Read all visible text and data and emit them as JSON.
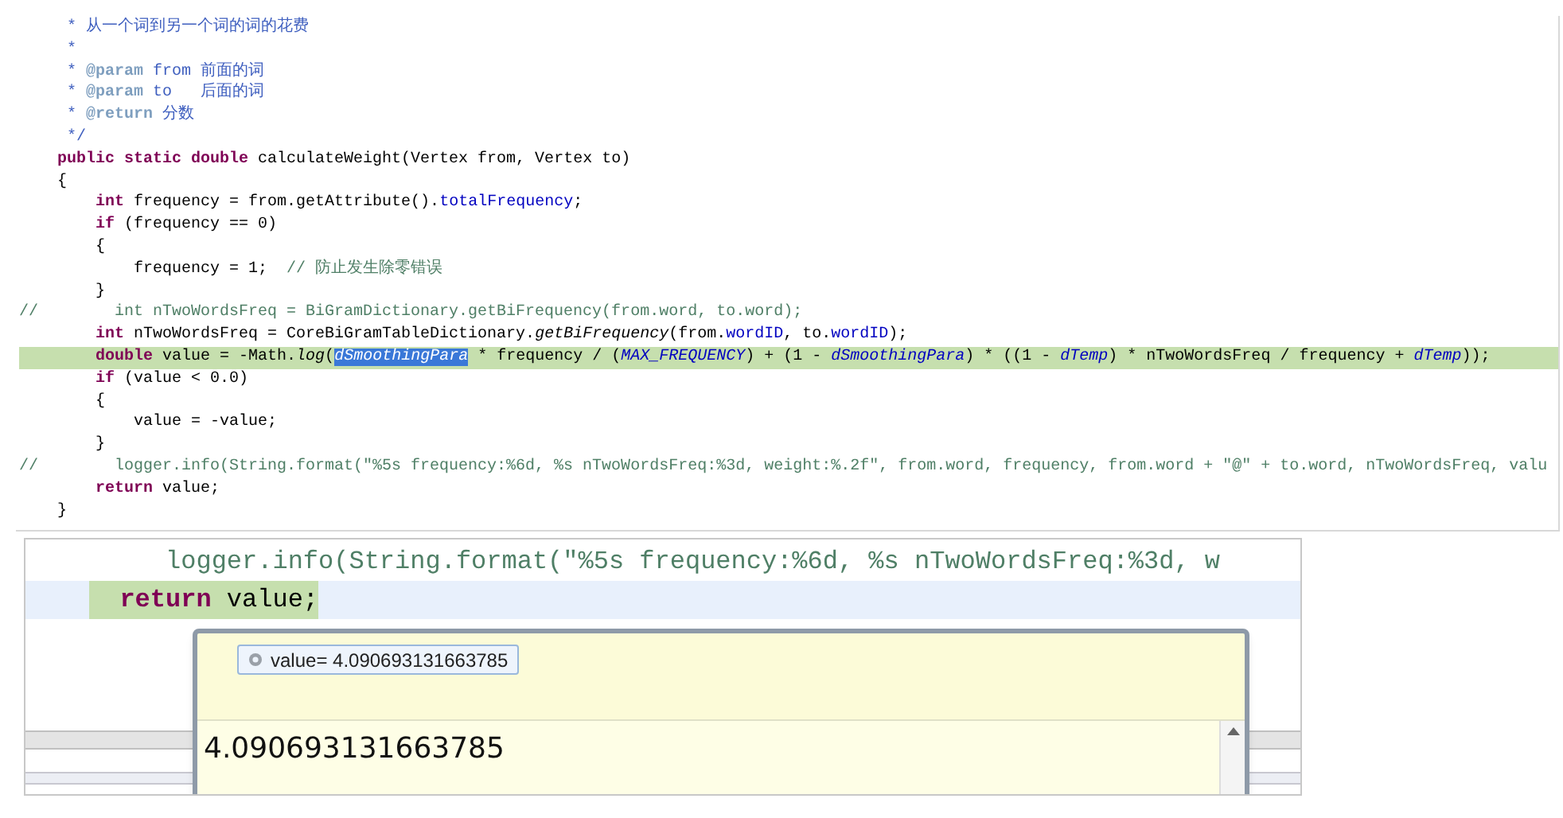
{
  "editor": {
    "lines": [
      {
        "current": false,
        "tokens": [
          {
            "kind": "doc",
            "text": "     * 从一个词到另一个词的词的花费"
          }
        ]
      },
      {
        "current": false,
        "tokens": [
          {
            "kind": "doc",
            "text": "     *"
          }
        ]
      },
      {
        "current": false,
        "tokens": [
          {
            "kind": "doc",
            "text": "     * "
          },
          {
            "kind": "doctag",
            "text": "@param"
          },
          {
            "kind": "doc",
            "text": " from 前面的词"
          }
        ]
      },
      {
        "current": false,
        "tokens": [
          {
            "kind": "doc",
            "text": "     * "
          },
          {
            "kind": "doctag",
            "text": "@param"
          },
          {
            "kind": "doc",
            "text": " to   后面的词"
          }
        ]
      },
      {
        "current": false,
        "tokens": [
          {
            "kind": "doc",
            "text": "     * "
          },
          {
            "kind": "doctag",
            "text": "@return"
          },
          {
            "kind": "doc",
            "text": " 分数"
          }
        ]
      },
      {
        "current": false,
        "tokens": [
          {
            "kind": "doc",
            "text": "     */"
          }
        ]
      },
      {
        "current": false,
        "tokens": [
          {
            "kind": "keyword",
            "text": "    public static double"
          },
          {
            "kind": "plain",
            "text": " calculateWeight(Vertex from, Vertex to)"
          }
        ]
      },
      {
        "current": false,
        "tokens": [
          {
            "kind": "plain",
            "text": "    {"
          }
        ]
      },
      {
        "current": false,
        "tokens": [
          {
            "kind": "keyword",
            "text": "        int"
          },
          {
            "kind": "plain",
            "text": " frequency = from.getAttribute()."
          },
          {
            "kind": "field",
            "text": "totalFrequency"
          },
          {
            "kind": "plain",
            "text": ";"
          }
        ]
      },
      {
        "current": false,
        "tokens": [
          {
            "kind": "keyword",
            "text": "        if"
          },
          {
            "kind": "plain",
            "text": " (frequency == 0)"
          }
        ]
      },
      {
        "current": false,
        "tokens": [
          {
            "kind": "plain",
            "text": "        {"
          }
        ]
      },
      {
        "current": false,
        "tokens": [
          {
            "kind": "plain",
            "text": "            frequency = 1;  "
          },
          {
            "kind": "comment",
            "text": "// 防止发生除零错误"
          }
        ]
      },
      {
        "current": false,
        "tokens": [
          {
            "kind": "plain",
            "text": "        }"
          }
        ]
      },
      {
        "current": false,
        "tokens": [
          {
            "kind": "comment",
            "text": "//        int nTwoWordsFreq = BiGramDictionary.getBiFrequency(from.word, to.word);"
          }
        ]
      },
      {
        "current": false,
        "tokens": [
          {
            "kind": "keyword",
            "text": "        int"
          },
          {
            "kind": "plain",
            "text": " nTwoWordsFreq = CoreBiGramTableDictionary."
          },
          {
            "kind": "static_method",
            "text": "getBiFrequency"
          },
          {
            "kind": "plain",
            "text": "(from."
          },
          {
            "kind": "field",
            "text": "wordID"
          },
          {
            "kind": "plain",
            "text": ", to."
          },
          {
            "kind": "field",
            "text": "wordID"
          },
          {
            "kind": "plain",
            "text": ");"
          }
        ]
      },
      {
        "current": true,
        "tokens": [
          {
            "kind": "keyword",
            "text": "        double"
          },
          {
            "kind": "plain",
            "text": " value = -Math."
          },
          {
            "kind": "static_method",
            "text": "log"
          },
          {
            "kind": "plain",
            "text": "("
          },
          {
            "kind": "selection",
            "text": "dSmoothingPara"
          },
          {
            "kind": "plain",
            "text": " * frequency / ("
          },
          {
            "kind": "static_field",
            "text": "MAX_FREQUENCY"
          },
          {
            "kind": "plain",
            "text": ") + (1 - "
          },
          {
            "kind": "static_field",
            "text": "dSmoothingPara"
          },
          {
            "kind": "plain",
            "text": ") * ((1 - "
          },
          {
            "kind": "static_field",
            "text": "dTemp"
          },
          {
            "kind": "plain",
            "text": ") * nTwoWordsFreq / frequency + "
          },
          {
            "kind": "static_field",
            "text": "dTemp"
          },
          {
            "kind": "plain",
            "text": "));"
          }
        ]
      },
      {
        "current": false,
        "tokens": [
          {
            "kind": "keyword",
            "text": "        if"
          },
          {
            "kind": "plain",
            "text": " (value < 0.0)"
          }
        ]
      },
      {
        "current": false,
        "tokens": [
          {
            "kind": "plain",
            "text": "        {"
          }
        ]
      },
      {
        "current": false,
        "tokens": [
          {
            "kind": "plain",
            "text": "            value = -value;"
          }
        ]
      },
      {
        "current": false,
        "tokens": [
          {
            "kind": "plain",
            "text": "        }"
          }
        ]
      },
      {
        "current": false,
        "tokens": [
          {
            "kind": "comment",
            "text": "//        logger.info(String.format(\"%5s frequency:%6d, %s nTwoWordsFreq:%3d, weight:%.2f\", from.word, frequency, from.word + \"@\" + to.word, nTwoWordsFreq, valu"
          }
        ]
      },
      {
        "current": false,
        "tokens": [
          {
            "kind": "keyword",
            "text": "        return"
          },
          {
            "kind": "plain",
            "text": " value;"
          }
        ]
      },
      {
        "current": false,
        "tokens": [
          {
            "kind": "plain",
            "text": "    }"
          }
        ]
      }
    ]
  },
  "zoomed_editor": {
    "lines": [
      {
        "current": false,
        "tokens": [
          {
            "kind": "comment",
            "text": "     logger.info(String.format(\"%5s frequency:%6d, %s nTwoWordsFreq:%3d, w"
          }
        ]
      },
      {
        "current": true,
        "tokens": [
          {
            "kind": "keyword",
            "text": "  return"
          },
          {
            "kind": "plain",
            "text": " value;"
          }
        ]
      }
    ],
    "hover": {
      "expression": "value= 4.090693131663785",
      "detail": "4.090693131663785"
    }
  }
}
